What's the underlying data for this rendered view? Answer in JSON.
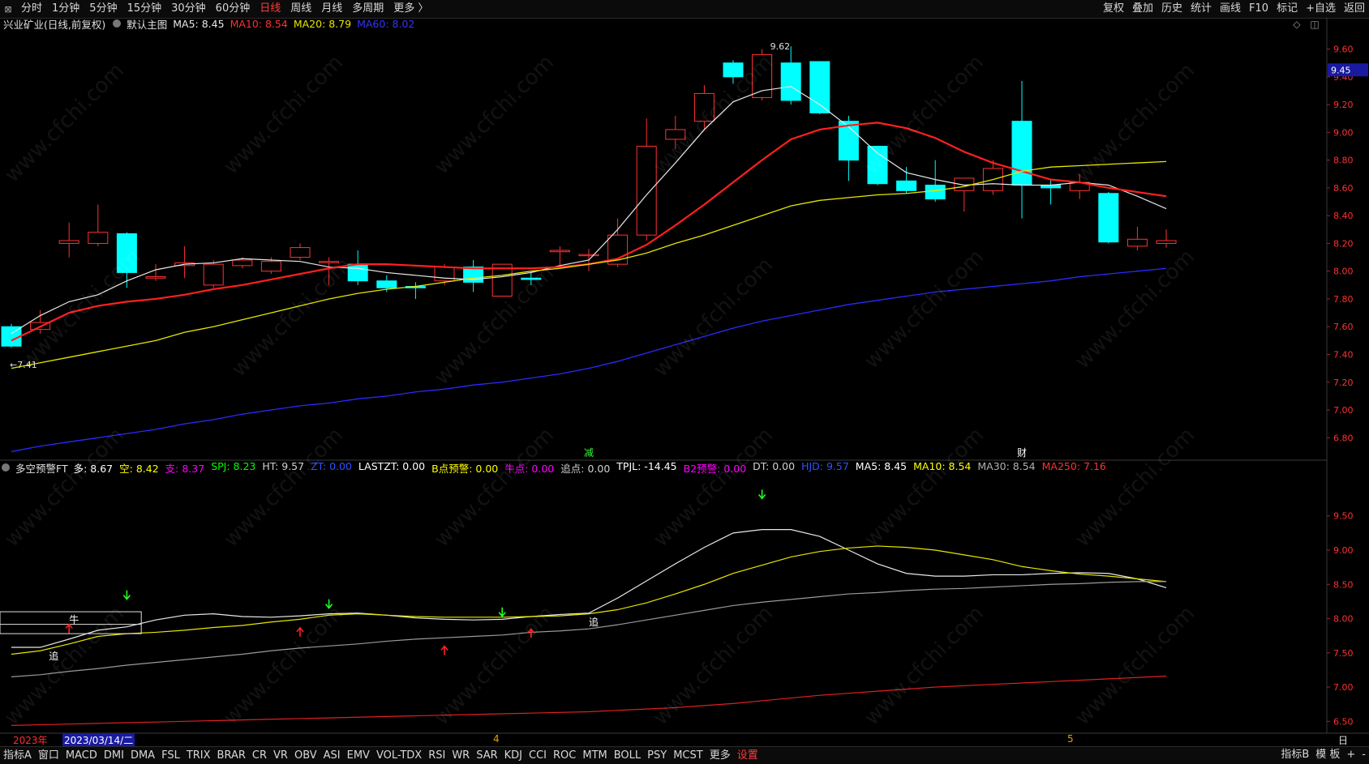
{
  "toolbar": {
    "tabs": [
      "分时",
      "1分钟",
      "5分钟",
      "15分钟",
      "30分钟",
      "60分钟",
      "日线",
      "周线",
      "月线",
      "多周期",
      "更多 〉"
    ],
    "active_index": 6,
    "right": [
      "复权",
      "叠加",
      "历史",
      "统计",
      "画线",
      "F10",
      "标记",
      "+自选",
      "返回"
    ]
  },
  "main_header": {
    "stock": "兴业矿业(日线,前复权)",
    "template": "默认主图",
    "ma5": "MA5: 8.45",
    "ma10": "MA10: 8.54",
    "ma20": "MA20: 8.79",
    "ma60": "MA60: 8.02"
  },
  "indicator_header": {
    "name": "多空预警FT",
    "items": [
      {
        "text": "多: 8.67",
        "color": "#ffffff"
      },
      {
        "text": "空: 8.42",
        "color": "#ffff00"
      },
      {
        "text": "支: 8.37",
        "color": "#ff00ff"
      },
      {
        "text": "SPJ: 8.23",
        "color": "#00ff00"
      },
      {
        "text": "HT: 9.57",
        "color": "#d0d0d0"
      },
      {
        "text": "ZT: 0.00",
        "color": "#3050ff"
      },
      {
        "text": "LASTZT: 0.00",
        "color": "#ffffff"
      },
      {
        "text": "B点预警: 0.00",
        "color": "#ffff00"
      },
      {
        "text": "牛点: 0.00",
        "color": "#ff00ff"
      },
      {
        "text": "追点: 0.00",
        "color": "#d0d0d0"
      },
      {
        "text": "TPJL: -14.45",
        "color": "#ffffff"
      },
      {
        "text": "B2预警: 0.00",
        "color": "#ff00ff"
      },
      {
        "text": "DT: 0.00",
        "color": "#d0d0d0"
      },
      {
        "text": "HJD: 9.57",
        "color": "#3050ff"
      },
      {
        "text": "MA5: 8.45",
        "color": "#ffffff"
      },
      {
        "text": "MA10: 8.54",
        "color": "#ffff00"
      },
      {
        "text": "MA30: 8.54",
        "color": "#b0b0b0"
      },
      {
        "text": "MA250: 7.16",
        "color": "#ff3030"
      }
    ]
  },
  "annotations": {
    "high_label": "9.62",
    "low_label": "←7.41",
    "price_tag": "9.45",
    "event_1": "减",
    "event_2": "财",
    "bull_label": "牛",
    "chase_label_1": "追",
    "chase_label_2": "追",
    "period_label": "日线",
    "watermark": "www.cfchi.com"
  },
  "dates": {
    "year_label": "2023年",
    "cursor_date": "2023/03/14/二",
    "month_4": "4",
    "month_5": "5"
  },
  "bottom_tabs": [
    "指标A",
    "窗口",
    "MACD",
    "DMI",
    "DMA",
    "FSL",
    "TRIX",
    "BRAR",
    "CR",
    "VR",
    "OBV",
    "ASI",
    "EMV",
    "VOL-TDX",
    "RSI",
    "WR",
    "SAR",
    "KDJ",
    "CCI",
    "ROC",
    "MTM",
    "BOLL",
    "PSY",
    "MCST",
    "更多",
    "设置"
  ],
  "bottom_red_index": 25,
  "bottom_right": [
    "指标B",
    "模 板",
    "+",
    "-"
  ],
  "colors": {
    "up": "#ff3232",
    "down": "#00ffff",
    "ma5": "#e8e8e8",
    "ma10": "#ff2020",
    "ma20": "#e6e600",
    "ma60": "#2a2aff",
    "ind_white": "#e8e8e8",
    "ind_yellow": "#e6e600",
    "ind_gray": "#9a9a9a",
    "ind_red": "#e02020"
  },
  "chart_data": [
    {
      "type": "candlestick",
      "title": "兴业矿业(日线,前复权)",
      "ylim": [
        6.65,
        9.72
      ],
      "yticks": [
        6.8,
        7.0,
        7.2,
        7.4,
        7.6,
        7.8,
        8.0,
        8.2,
        8.4,
        8.6,
        8.8,
        9.0,
        9.2,
        9.4,
        9.6
      ],
      "candles": [
        [
          7.6,
          7.62,
          7.45,
          7.46
        ],
        [
          7.58,
          7.72,
          7.55,
          7.63
        ],
        [
          8.2,
          8.35,
          8.1,
          8.22
        ],
        [
          8.2,
          8.48,
          8.18,
          8.28
        ],
        [
          8.27,
          8.28,
          7.88,
          7.99
        ],
        [
          7.95,
          8.05,
          7.93,
          7.96
        ],
        [
          8.04,
          8.18,
          7.95,
          8.06
        ],
        [
          7.9,
          8.08,
          7.88,
          8.05
        ],
        [
          8.04,
          8.1,
          8.02,
          8.08
        ],
        [
          8.0,
          8.1,
          7.98,
          8.07
        ],
        [
          8.1,
          8.2,
          8.08,
          8.17
        ],
        [
          8.07,
          8.1,
          7.9,
          8.07
        ],
        [
          8.05,
          8.15,
          7.9,
          7.93
        ],
        [
          7.93,
          7.97,
          7.85,
          7.88
        ],
        [
          7.89,
          7.92,
          7.8,
          7.88
        ],
        [
          7.93,
          8.05,
          7.9,
          8.03
        ],
        [
          8.03,
          8.08,
          7.85,
          7.92
        ],
        [
          7.82,
          8.05,
          7.82,
          8.05
        ],
        [
          7.95,
          8.0,
          7.9,
          7.94
        ],
        [
          8.14,
          8.18,
          8.03,
          8.15
        ],
        [
          8.12,
          8.16,
          8.0,
          8.12
        ],
        [
          8.05,
          8.38,
          8.03,
          8.26
        ],
        [
          8.26,
          9.1,
          8.22,
          8.9
        ],
        [
          8.95,
          9.12,
          8.88,
          9.02
        ],
        [
          9.08,
          9.34,
          9.02,
          9.28
        ],
        [
          9.5,
          9.52,
          9.35,
          9.4
        ],
        [
          9.25,
          9.6,
          9.23,
          9.56
        ],
        [
          9.5,
          9.62,
          9.2,
          9.23
        ],
        [
          9.51,
          9.51,
          9.13,
          9.14
        ],
        [
          9.08,
          9.12,
          8.65,
          8.8
        ],
        [
          8.9,
          8.9,
          8.62,
          8.63
        ],
        [
          8.65,
          8.75,
          8.56,
          8.58
        ],
        [
          8.62,
          8.8,
          8.5,
          8.52
        ],
        [
          8.58,
          8.67,
          8.43,
          8.67
        ],
        [
          8.58,
          8.8,
          8.55,
          8.74
        ],
        [
          9.08,
          9.37,
          8.38,
          8.62
        ],
        [
          8.62,
          8.66,
          8.48,
          8.6
        ],
        [
          8.58,
          8.7,
          8.52,
          8.64
        ],
        [
          8.56,
          8.57,
          8.2,
          8.21
        ],
        [
          8.18,
          8.32,
          8.15,
          8.23
        ],
        [
          8.2,
          8.3,
          8.17,
          8.22
        ]
      ],
      "series": [
        {
          "name": "MA5",
          "values": [
            7.55,
            7.68,
            7.78,
            7.83,
            7.93,
            8.01,
            8.05,
            8.06,
            8.09,
            8.08,
            8.07,
            8.03,
            8.02,
            7.99,
            7.97,
            7.95,
            7.94,
            7.96,
            7.99,
            8.04,
            8.08,
            8.3,
            8.55,
            8.78,
            9.02,
            9.22,
            9.3,
            9.33,
            9.2,
            9.04,
            8.85,
            8.71,
            8.66,
            8.62,
            8.63,
            8.62,
            8.62,
            8.64,
            8.62,
            8.54,
            8.45
          ]
        },
        {
          "name": "MA10",
          "values": [
            7.5,
            7.6,
            7.7,
            7.75,
            7.78,
            7.8,
            7.83,
            7.87,
            7.9,
            7.94,
            7.98,
            8.02,
            8.05,
            8.05,
            8.04,
            8.03,
            8.02,
            8.02,
            8.02,
            8.03,
            8.05,
            8.09,
            8.19,
            8.33,
            8.48,
            8.64,
            8.8,
            8.95,
            9.02,
            9.05,
            9.07,
            9.03,
            8.96,
            8.86,
            8.78,
            8.72,
            8.66,
            8.64,
            8.6,
            8.57,
            8.54
          ]
        },
        {
          "name": "MA20",
          "values": [
            7.3,
            7.34,
            7.38,
            7.42,
            7.46,
            7.5,
            7.56,
            7.6,
            7.65,
            7.7,
            7.75,
            7.8,
            7.84,
            7.87,
            7.89,
            7.92,
            7.95,
            7.97,
            8.0,
            8.02,
            8.05,
            8.08,
            8.13,
            8.2,
            8.26,
            8.33,
            8.4,
            8.47,
            8.51,
            8.53,
            8.55,
            8.56,
            8.58,
            8.61,
            8.66,
            8.72,
            8.75,
            8.76,
            8.77,
            8.78,
            8.79
          ]
        },
        {
          "name": "MA60",
          "values": [
            6.7,
            6.74,
            6.77,
            6.8,
            6.83,
            6.86,
            6.9,
            6.93,
            6.97,
            7.0,
            7.03,
            7.05,
            7.08,
            7.1,
            7.13,
            7.15,
            7.18,
            7.2,
            7.23,
            7.26,
            7.3,
            7.35,
            7.41,
            7.47,
            7.53,
            7.59,
            7.64,
            7.68,
            7.72,
            7.76,
            7.79,
            7.82,
            7.85,
            7.87,
            7.89,
            7.91,
            7.93,
            7.96,
            7.98,
            8.0,
            8.02
          ]
        }
      ],
      "high_point": {
        "bar": 26,
        "value": 9.62
      },
      "low_point": {
        "bar": 0,
        "value": 7.41
      },
      "events": [
        {
          "bar": 20,
          "label": "减"
        },
        {
          "bar": 35,
          "label": "财"
        }
      ]
    },
    {
      "type": "line",
      "title": "多空预警FT",
      "ylim": [
        6.35,
        10.1
      ],
      "yticks": [
        6.5,
        7.0,
        7.5,
        8.0,
        8.5,
        9.0,
        9.5
      ],
      "series": [
        {
          "name": "多",
          "values": [
            7.58,
            7.58,
            7.7,
            7.83,
            7.88,
            7.98,
            8.05,
            8.07,
            8.03,
            8.02,
            8.04,
            8.07,
            8.08,
            8.05,
            8.01,
            7.99,
            7.98,
            7.99,
            8.03,
            8.06,
            8.08,
            8.3,
            8.55,
            8.8,
            9.04,
            9.25,
            9.3,
            9.3,
            9.2,
            9.0,
            8.8,
            8.66,
            8.62,
            8.62,
            8.64,
            8.64,
            8.66,
            8.67,
            8.66,
            8.58,
            8.45
          ]
        },
        {
          "name": "空",
          "values": [
            7.48,
            7.53,
            7.63,
            7.74,
            7.78,
            7.8,
            7.83,
            7.87,
            7.9,
            7.95,
            7.99,
            8.05,
            8.07,
            8.05,
            8.03,
            8.02,
            8.02,
            8.02,
            8.03,
            8.04,
            8.07,
            8.13,
            8.23,
            8.36,
            8.5,
            8.66,
            8.78,
            8.9,
            8.98,
            9.03,
            9.06,
            9.04,
            9.0,
            8.93,
            8.86,
            8.76,
            8.7,
            8.65,
            8.62,
            8.58,
            8.54
          ]
        },
        {
          "name": "支",
          "values": [
            7.15,
            7.18,
            7.23,
            7.27,
            7.32,
            7.36,
            7.4,
            7.44,
            7.48,
            7.53,
            7.57,
            7.6,
            7.63,
            7.67,
            7.7,
            7.72,
            7.74,
            7.76,
            7.8,
            7.82,
            7.85,
            7.91,
            7.98,
            8.05,
            8.12,
            8.19,
            8.24,
            8.28,
            8.32,
            8.36,
            8.38,
            8.41,
            8.43,
            8.44,
            8.46,
            8.48,
            8.5,
            8.51,
            8.53,
            8.54,
            8.54
          ]
        },
        {
          "name": "MA250",
          "values": [
            6.44,
            6.45,
            6.46,
            6.47,
            6.48,
            6.49,
            6.5,
            6.51,
            6.52,
            6.53,
            6.54,
            6.55,
            6.56,
            6.57,
            6.58,
            6.59,
            6.6,
            6.61,
            6.62,
            6.63,
            6.64,
            6.66,
            6.68,
            6.7,
            6.73,
            6.76,
            6.8,
            6.84,
            6.88,
            6.91,
            6.94,
            6.97,
            7.0,
            7.02,
            7.04,
            7.06,
            7.08,
            7.1,
            7.12,
            7.14,
            7.16
          ]
        }
      ],
      "down_arrows": [
        {
          "bar": 4,
          "value": 8.33
        },
        {
          "bar": 11,
          "value": 8.2
        },
        {
          "bar": 17,
          "value": 8.08
        },
        {
          "bar": 26,
          "value": 9.8
        }
      ],
      "up_arrows": [
        {
          "bar": 2,
          "value": 7.87
        },
        {
          "bar": 10,
          "value": 7.82
        },
        {
          "bar": 15,
          "value": 7.55
        },
        {
          "bar": 18,
          "value": 7.8
        }
      ],
      "bull_box": {
        "bar_start": 0,
        "bar_end": 4.5,
        "top": 8.1,
        "bottom": 7.78
      },
      "chase_marks": [
        {
          "bar": 1.3,
          "value": 7.4
        },
        {
          "bar": 20,
          "value": 7.9
        }
      ]
    }
  ]
}
